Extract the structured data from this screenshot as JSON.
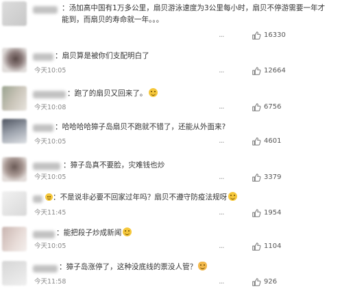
{
  "comments": [
    {
      "text": "：汤加高中国有1万多公里，扇贝游泳速度为3公里每小时，扇贝不停游需要一年才能到，而扇贝的寿命就一年。。。",
      "time": "",
      "likes": "16330",
      "emoji": ""
    },
    {
      "text": "：扇贝算是被你们支配明白了",
      "time": "今天10:05",
      "likes": "12664",
      "emoji": ""
    },
    {
      "text": "：跑了的扇贝又回来了。",
      "time": "今天10:08",
      "likes": "6756",
      "emoji": "grin"
    },
    {
      "text": "：哈哈哈哈獐子岛扇贝不跑就不错了，还能从外面来?",
      "time": "今天10:05",
      "likes": "4601",
      "emoji": ""
    },
    {
      "text": "：獐子岛真不要脸，灾难钱也炒",
      "time": "今天10:05",
      "likes": "3379",
      "emoji": ""
    },
    {
      "text": "：不是说非必要不回家过年吗？扇贝不遵守防疫法规呀",
      "time": "今天11:45",
      "likes": "1954",
      "emoji": "smirk"
    },
    {
      "text": "：能把段子炒成新闻",
      "time": "今天10:05",
      "likes": "1104",
      "emoji": "laugh"
    },
    {
      "text": "：獐子岛涨停了，这种没底线的票没人管？",
      "time": "今天11:58",
      "likes": "926",
      "emoji": "cat"
    }
  ]
}
